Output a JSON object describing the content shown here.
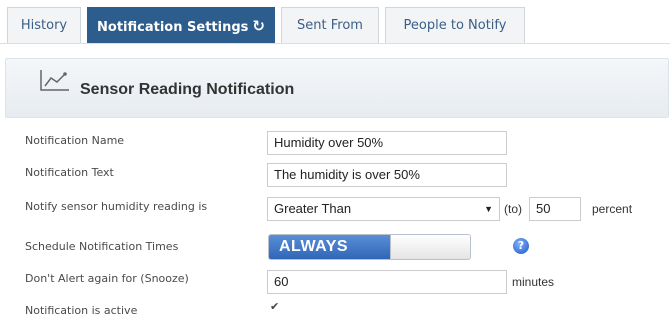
{
  "tabs": [
    {
      "label": "History",
      "active": false
    },
    {
      "label": "Notification Settings",
      "active": true
    },
    {
      "label": "Sent From",
      "active": false
    },
    {
      "label": "People to Notify",
      "active": false
    }
  ],
  "panel": {
    "title": "Sensor Reading Notification",
    "icon": "line-chart-icon"
  },
  "form": {
    "notification_name": {
      "label": "Notification Name",
      "value": "Humidity over 50%"
    },
    "notification_text": {
      "label": "Notification Text",
      "value": "The humidity is over 50%"
    },
    "notify_reading": {
      "label": "Notify sensor humidity reading is",
      "selected": "Greater Than",
      "to_label": "(to)",
      "value": "50",
      "unit": "percent"
    },
    "schedule": {
      "label": "Schedule Notification Times",
      "toggle_text": "ALWAYS",
      "help_icon": "question-icon"
    },
    "snooze": {
      "label": "Don't Alert again for (Snooze)",
      "value": "60",
      "unit": "minutes"
    },
    "active": {
      "label": "Notification is active",
      "checked": true
    }
  },
  "colors": {
    "tab_active": "#2c5d8c",
    "toggle_on": "#2f66b8"
  }
}
